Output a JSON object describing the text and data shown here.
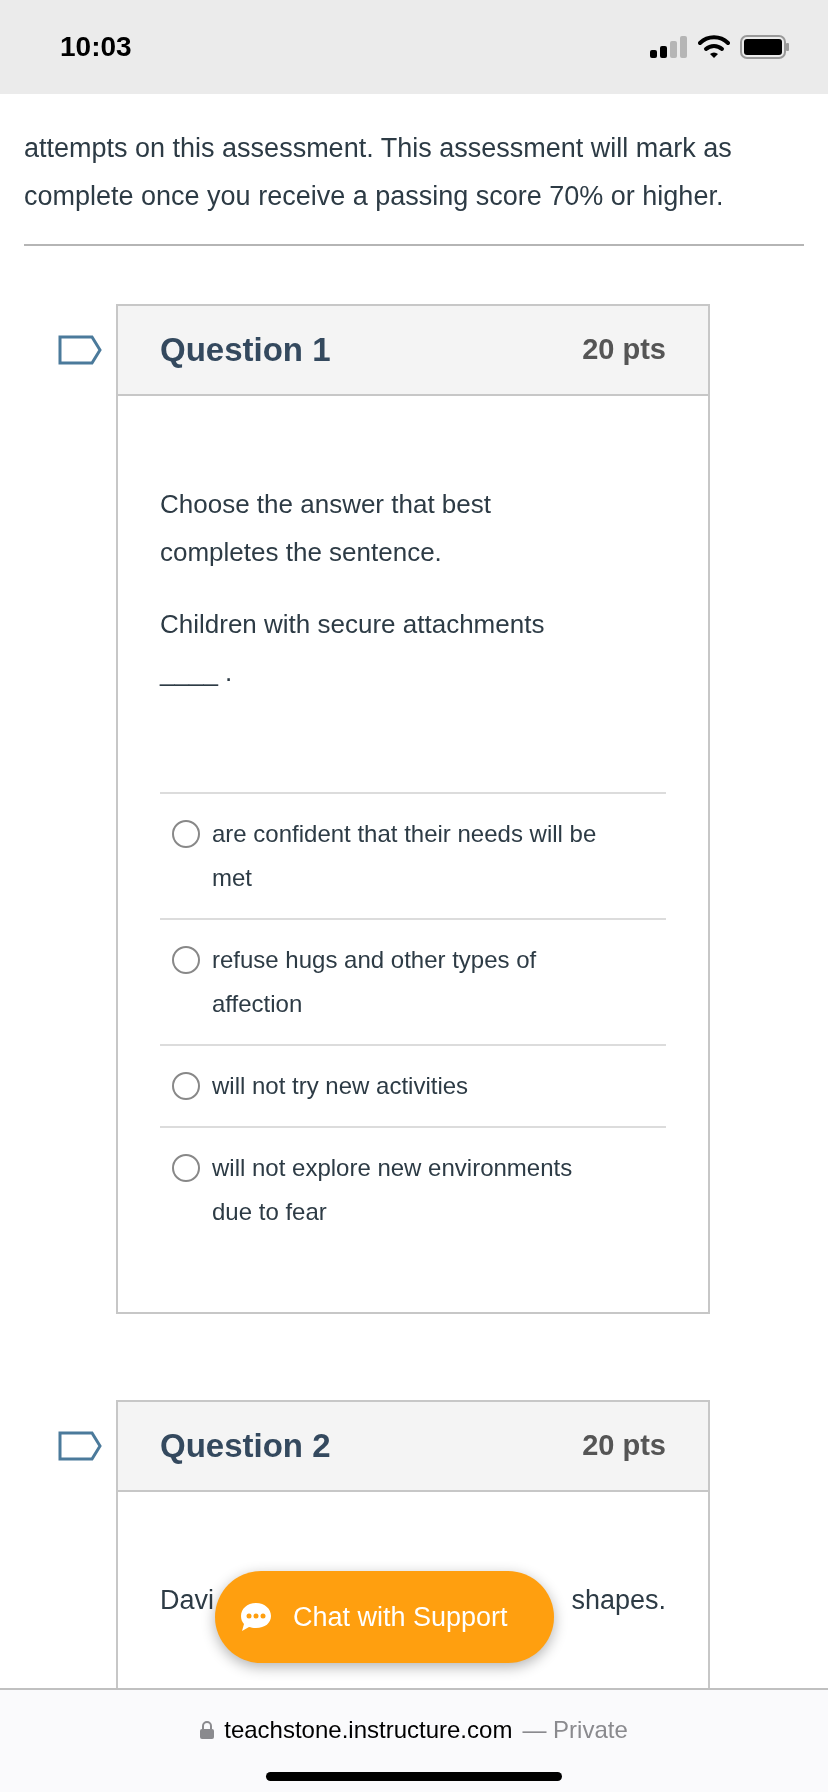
{
  "status_bar": {
    "time": "10:03"
  },
  "intro": {
    "text": "attempts on this assessment. This assessment will mark as complete once you receive a passing score 70% or higher."
  },
  "questions": [
    {
      "kind": "choice",
      "title": "Question 1",
      "points": "20 pts",
      "flagged": false,
      "prompt": [
        "Choose the answer that best completes the sentence.",
        "Children with secure attachments ____ ."
      ],
      "answers": [
        {
          "text": "are confident that their needs will be met",
          "selected": false
        },
        {
          "text": "refuse hugs and other types of affection",
          "selected": false
        },
        {
          "text": "will not try new activities",
          "selected": false
        },
        {
          "text": "will not explore new environments due to fear",
          "selected": false
        }
      ]
    },
    {
      "kind": "partial",
      "title": "Question 2",
      "points": "20 pts",
      "flagged": false,
      "fragments": [
        "Davi",
        "shapes."
      ]
    }
  ],
  "chat_button": {
    "label": "Chat with Support"
  },
  "browser_bar": {
    "url": "teachstone.instructure.com",
    "suffix": "— Private"
  }
}
